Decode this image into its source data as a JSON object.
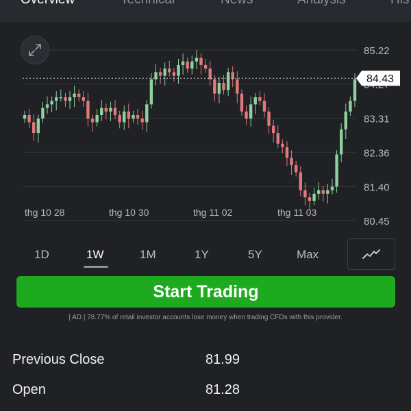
{
  "tabs": [
    {
      "label": "Overview",
      "active": true
    },
    {
      "label": "Technical",
      "active": false
    },
    {
      "label": "News",
      "active": false
    },
    {
      "label": "Analysis",
      "active": false
    },
    {
      "label": "His",
      "active": false
    }
  ],
  "chart_data": {
    "type": "candlestick",
    "x_tick_labels": [
      "thg 10 28",
      "thg 10 30",
      "thg 11 02",
      "thg 11 03"
    ],
    "y_tick_labels": [
      "85.22",
      "84.27",
      "83.31",
      "82.36",
      "81.40",
      "80.45"
    ],
    "y_ticks": [
      85.22,
      84.27,
      83.31,
      82.36,
      81.4,
      80.45
    ],
    "ylim": [
      80.45,
      85.22
    ],
    "current_price": 84.43,
    "current_price_label": "84.43",
    "up_color": "#8fd19e",
    "down_color": "#e07a7a",
    "close_series": [
      83.4,
      83.2,
      82.9,
      83.3,
      83.6,
      83.7,
      83.8,
      83.9,
      83.9,
      83.8,
      83.9,
      84.0,
      83.9,
      83.8,
      83.3,
      83.2,
      83.4,
      83.6,
      83.5,
      83.6,
      83.4,
      83.2,
      83.5,
      83.3,
      83.4,
      83.3,
      83.2,
      83.7,
      84.4,
      84.6,
      84.5,
      84.7,
      84.6,
      84.5,
      84.8,
      84.9,
      84.7,
      84.9,
      85.0,
      84.8,
      84.7,
      84.4,
      84.0,
      84.3,
      84.1,
      84.6,
      84.4,
      84.0,
      83.5,
      83.3,
      83.7,
      83.9,
      83.8,
      83.5,
      83.1,
      82.9,
      82.6,
      82.5,
      82.2,
      82.0,
      81.8,
      81.3,
      81.1,
      81.0,
      81.2,
      81.3,
      81.2,
      81.3,
      81.4,
      82.3,
      83.0,
      83.5,
      83.8,
      84.4
    ],
    "grid": true
  },
  "ranges": [
    {
      "label": "1D",
      "active": false
    },
    {
      "label": "1W",
      "active": true
    },
    {
      "label": "1M",
      "active": false
    },
    {
      "label": "1Y",
      "active": false
    },
    {
      "label": "5Y",
      "active": false
    },
    {
      "label": "Max",
      "active": false
    }
  ],
  "cta": {
    "label": "Start Trading",
    "color": "#1eaa1e"
  },
  "disclaimer": "| AD | 78.77% of retail investor accounts lose money when trading CFDs with this provider.",
  "stats": [
    {
      "label": "Previous Close",
      "value": "81.99"
    },
    {
      "label": "Open",
      "value": "81.28"
    }
  ]
}
